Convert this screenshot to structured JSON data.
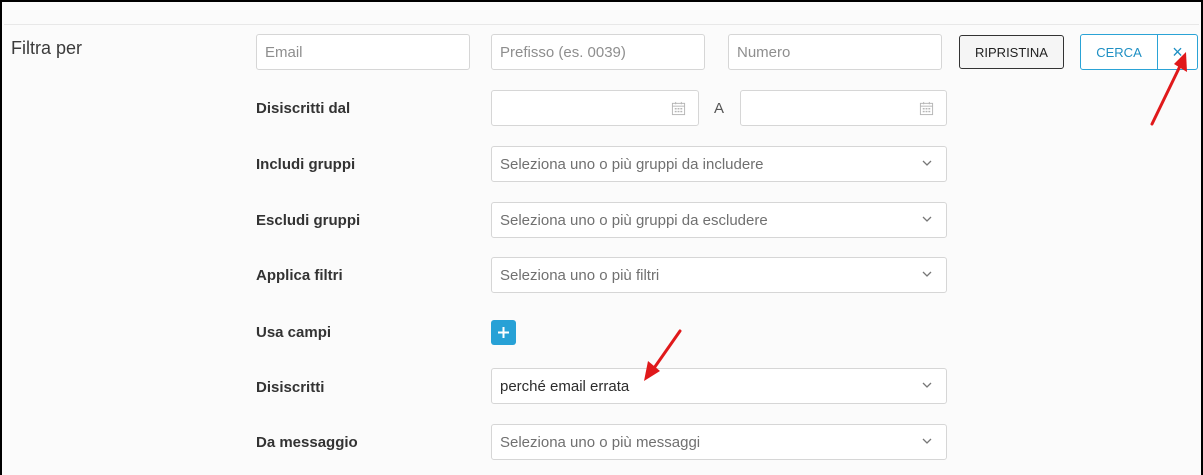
{
  "filter": {
    "title": "Filtra per",
    "email_placeholder": "Email",
    "prefix_placeholder": "Prefisso (es. 0039)",
    "number_placeholder": "Numero",
    "reset_label": "RIPRISTINA",
    "search_label": "CERCA",
    "close_glyph": "×"
  },
  "rows": {
    "unsubscribed_from": {
      "label": "Disiscritti dal",
      "separator": "A"
    },
    "include_groups": {
      "label": "Includi gruppi",
      "placeholder": "Seleziona uno o più gruppi da includere"
    },
    "exclude_groups": {
      "label": "Escludi gruppi",
      "placeholder": "Seleziona uno o più gruppi da escludere"
    },
    "apply_filters": {
      "label": "Applica filtri",
      "placeholder": "Seleziona uno o più filtri"
    },
    "use_fields": {
      "label": "Usa campi"
    },
    "unsubscribed": {
      "label": "Disiscritti",
      "value": "perché email errata"
    },
    "from_message": {
      "label": "Da messaggio",
      "placeholder": "Seleziona uno o più messaggi"
    }
  },
  "colors": {
    "accent": "#27a1d6",
    "annotation_arrow": "#e0191b"
  }
}
